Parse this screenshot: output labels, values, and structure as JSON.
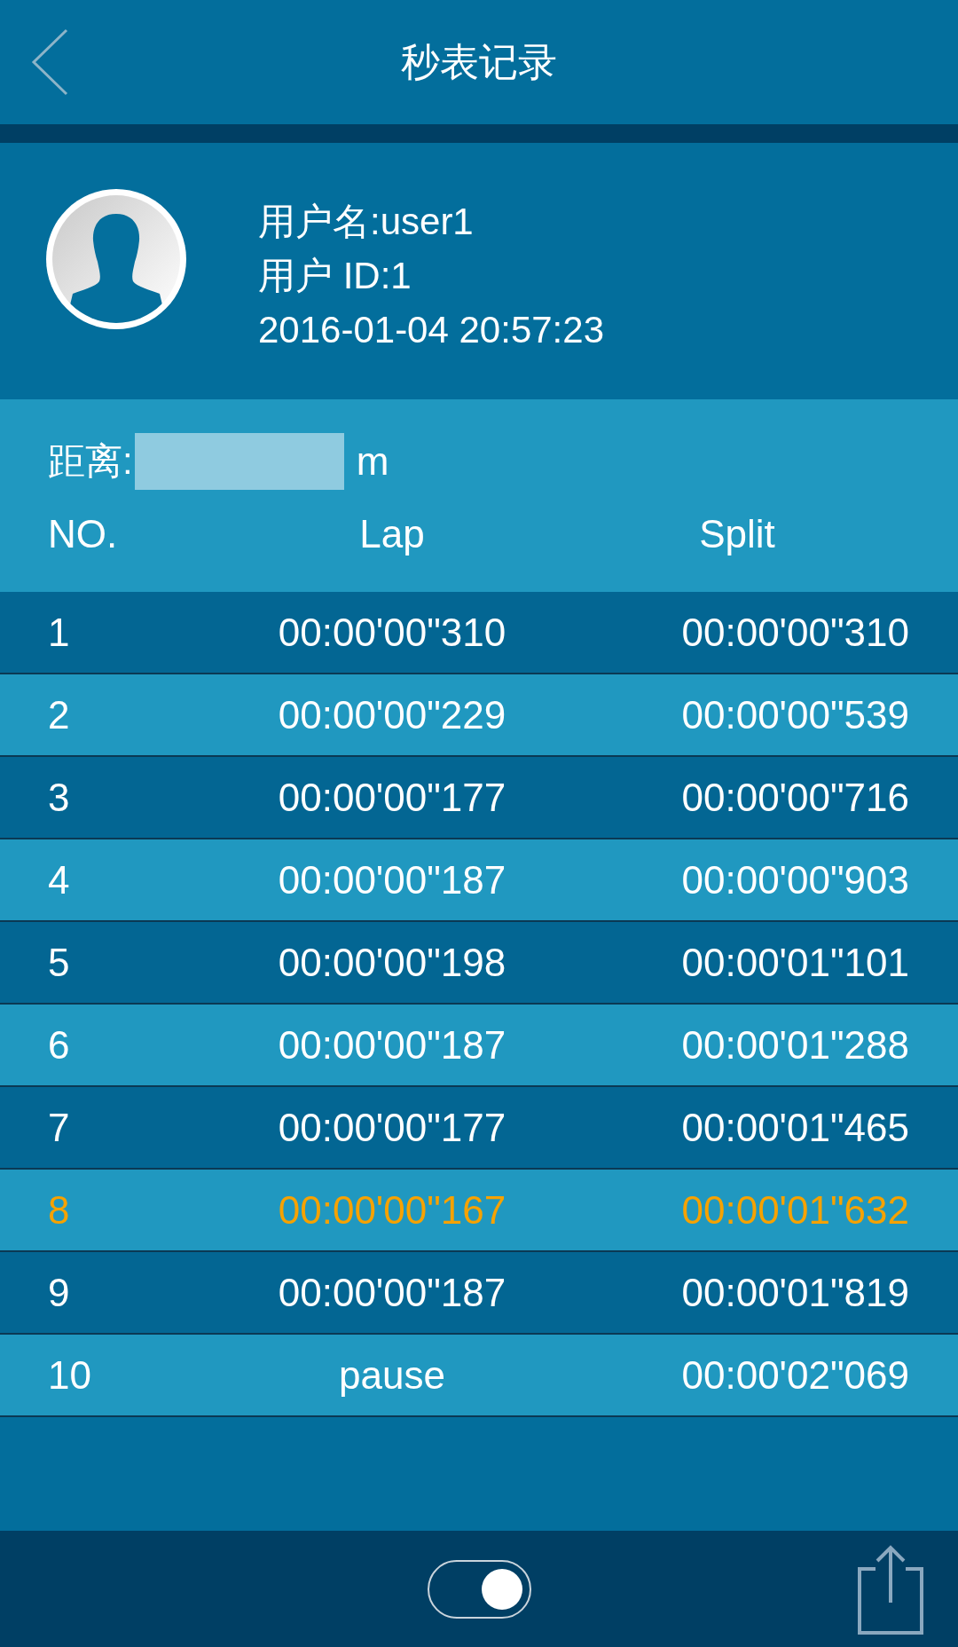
{
  "header": {
    "title": "秒表记录"
  },
  "user": {
    "name_line": "用户名:user1",
    "id_line": "用户 ID:1",
    "datetime": "2016-01-04 20:57:23"
  },
  "distance": {
    "label": "距离:",
    "unit": "m"
  },
  "table": {
    "columns": [
      "NO.",
      "Lap",
      "Split"
    ],
    "rows": [
      {
        "no": "1",
        "lap": "00:00'00\"310",
        "split": "00:00'00\"310",
        "selected": false
      },
      {
        "no": "2",
        "lap": "00:00'00\"229",
        "split": "00:00'00\"539",
        "selected": false
      },
      {
        "no": "3",
        "lap": "00:00'00\"177",
        "split": "00:00'00\"716",
        "selected": false
      },
      {
        "no": "4",
        "lap": "00:00'00\"187",
        "split": "00:00'00\"903",
        "selected": false
      },
      {
        "no": "5",
        "lap": "00:00'00\"198",
        "split": "00:00'01\"101",
        "selected": false
      },
      {
        "no": "6",
        "lap": "00:00'00\"187",
        "split": "00:00'01\"288",
        "selected": false
      },
      {
        "no": "7",
        "lap": "00:00'00\"177",
        "split": "00:00'01\"465",
        "selected": false
      },
      {
        "no": "8",
        "lap": "00:00'00\"167",
        "split": "00:00'01\"632",
        "selected": true
      },
      {
        "no": "9",
        "lap": "00:00'00\"187",
        "split": "00:00'01\"819",
        "selected": false
      },
      {
        "no": "10",
        "lap": "pause",
        "split": "00:00'02\"069",
        "selected": false
      }
    ]
  },
  "footer": {
    "toggle": {
      "on": true
    }
  }
}
